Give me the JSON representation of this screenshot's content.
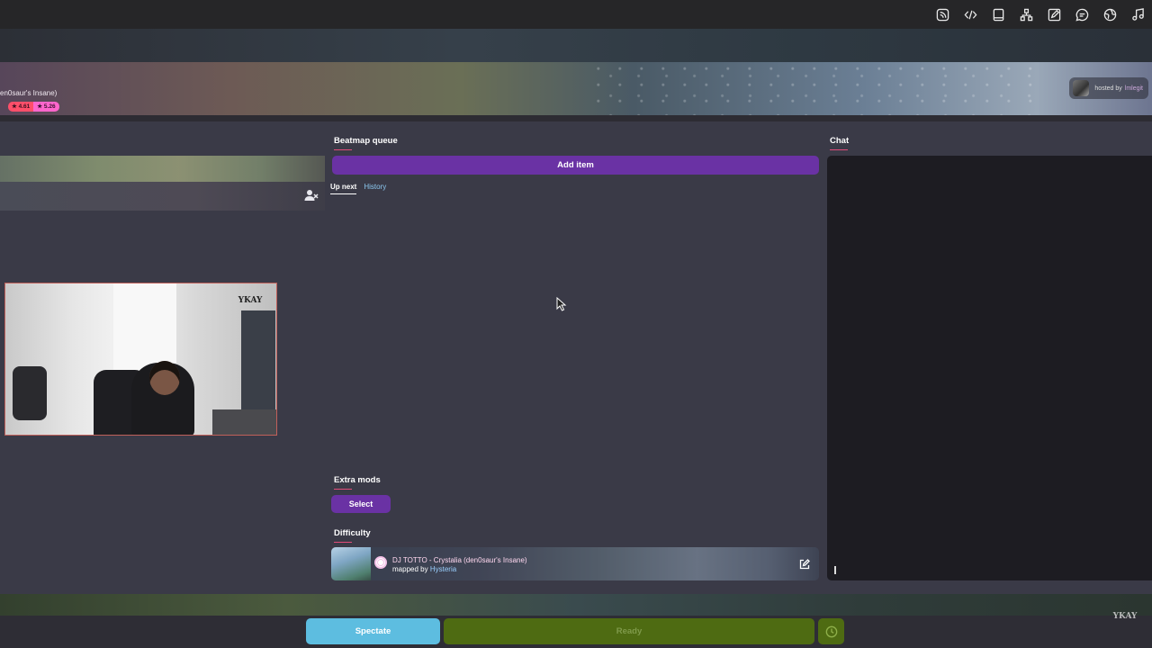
{
  "topbar": {
    "icons": [
      "rss-icon",
      "code-icon",
      "tablet-icon",
      "hierarchy-icon",
      "edit-square-icon",
      "chat-bubble-icon",
      "globe-icon",
      "music-note-icon"
    ]
  },
  "header": {
    "map_name": "en0saur's Insane)",
    "star_rating": "★ 4.61",
    "pp_rating": "★ 5.26",
    "hosted_by_label": "hosted by",
    "host_name": "lmlegit"
  },
  "queue": {
    "title": "Beatmap queue",
    "add_item_label": "Add item",
    "tabs": [
      {
        "label": "Up next",
        "active": true
      },
      {
        "label": "History",
        "active": false
      }
    ]
  },
  "extra_mods": {
    "title": "Extra mods",
    "select_label": "Select"
  },
  "difficulty": {
    "title": "Difficulty",
    "map_title": "DJ TOTTO - Crystalia (den0saur's Insane)",
    "mapped_by_label": "mapped by",
    "mapper": "Hysteria"
  },
  "chat": {
    "title": "Chat"
  },
  "footer": {
    "spectate_label": "Spectate",
    "ready_label": "Ready"
  },
  "webcam": {
    "logo_text": "YKAY"
  },
  "colors": {
    "accent_purple": "#6a32a4",
    "spectate_blue": "#5dbde0",
    "ready_green": "#4e6b12",
    "underline_pink": "#e24c7a"
  }
}
